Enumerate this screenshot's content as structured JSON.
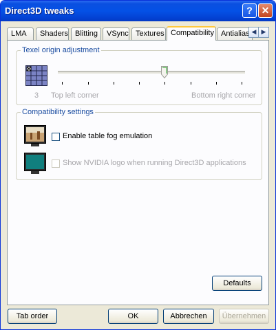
{
  "window": {
    "title": "Direct3D tweaks",
    "help_glyph": "?",
    "close_glyph": "✕"
  },
  "tabs": [
    {
      "label": "LMA"
    },
    {
      "label": "Shaders"
    },
    {
      "label": "Blitting"
    },
    {
      "label": "VSync"
    },
    {
      "label": "Textures"
    },
    {
      "label": "Compatibility",
      "active": true
    },
    {
      "label": "Antialias"
    }
  ],
  "tab_scroll": {
    "left": "◀",
    "right": "▶"
  },
  "texel": {
    "legend": "Texel origin adjustment",
    "value": "3",
    "min_label": "Top left corner",
    "max_label": "Bottom right corner",
    "slider_fraction": 0.57
  },
  "compat": {
    "legend": "Compatibility settings",
    "fog_label": "Enable table fog emulation",
    "fog_checked": false,
    "logo_label": "Show NVIDIA logo when running Direct3D applications",
    "logo_checked": false,
    "logo_enabled": false
  },
  "buttons": {
    "defaults": "Defaults",
    "tab_order": "Tab order",
    "ok": "OK",
    "cancel": "Abbrechen",
    "apply": "Übernehmen"
  }
}
